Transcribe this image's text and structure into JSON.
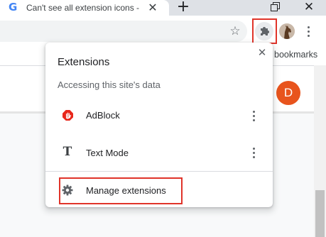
{
  "tab": {
    "favicon_letter": "G",
    "title": "Can't see all extension icons - G",
    "close_glyph": "✕"
  },
  "tabstrip": {
    "new_tab_glyph": "+"
  },
  "window_controls": {
    "close_glyph": "✕"
  },
  "toolbar": {
    "bookmark_star_glyph": "☆"
  },
  "bookmarks_bar": {
    "text": "bookmarks"
  },
  "page": {
    "avatar_letter": "D"
  },
  "extensions_popup": {
    "title": "Extensions",
    "close_glyph": "✕",
    "section_header": "Accessing this site's data",
    "items": [
      {
        "name": "AdBlock",
        "icon": "adblock-icon"
      },
      {
        "name": "Text Mode",
        "icon": "text-mode-icon",
        "icon_glyph": "T"
      }
    ],
    "manage_label": "Manage extensions"
  },
  "colors": {
    "highlight_box": "#e0342a",
    "adblock_red": "#e8271b",
    "avatar_orange": "#e8541d",
    "tabstrip_bg": "#dee1e6"
  }
}
